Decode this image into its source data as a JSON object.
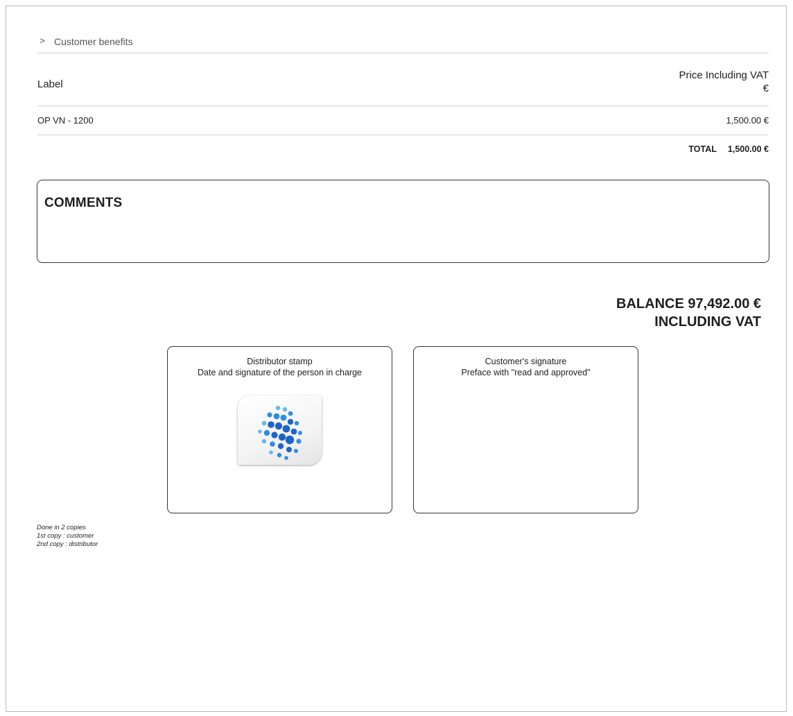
{
  "section": {
    "title": "Customer benefits",
    "icon": "chevron-right-icon"
  },
  "table": {
    "header": {
      "label": "Label",
      "price_line1": "Price Including VAT",
      "price_line2": "€"
    },
    "rows": [
      {
        "label": "OP VN - 1200",
        "price": "1,500.00 €"
      }
    ],
    "total_label": "TOTAL",
    "total_value": "1,500.00 €"
  },
  "comments": {
    "title": "COMMENTS"
  },
  "balance": {
    "line1": "BALANCE 97,492.00 €",
    "line2": "INCLUDING VAT"
  },
  "signatures": {
    "distributor": {
      "line1": "Distributor stamp",
      "line2": "Date and signature of the person in charge"
    },
    "customer": {
      "line1": "Customer's signature",
      "line2": "Preface with \"read and approved\""
    }
  },
  "logo": {
    "icon": "dots-sphere-logo",
    "colors": [
      "#1e63c9",
      "#2a8ee8",
      "#62b9f2"
    ]
  },
  "copies": {
    "line1": "Done in 2 copies",
    "line2": "1st copy : customer",
    "line3": "2nd copy : distributor"
  }
}
